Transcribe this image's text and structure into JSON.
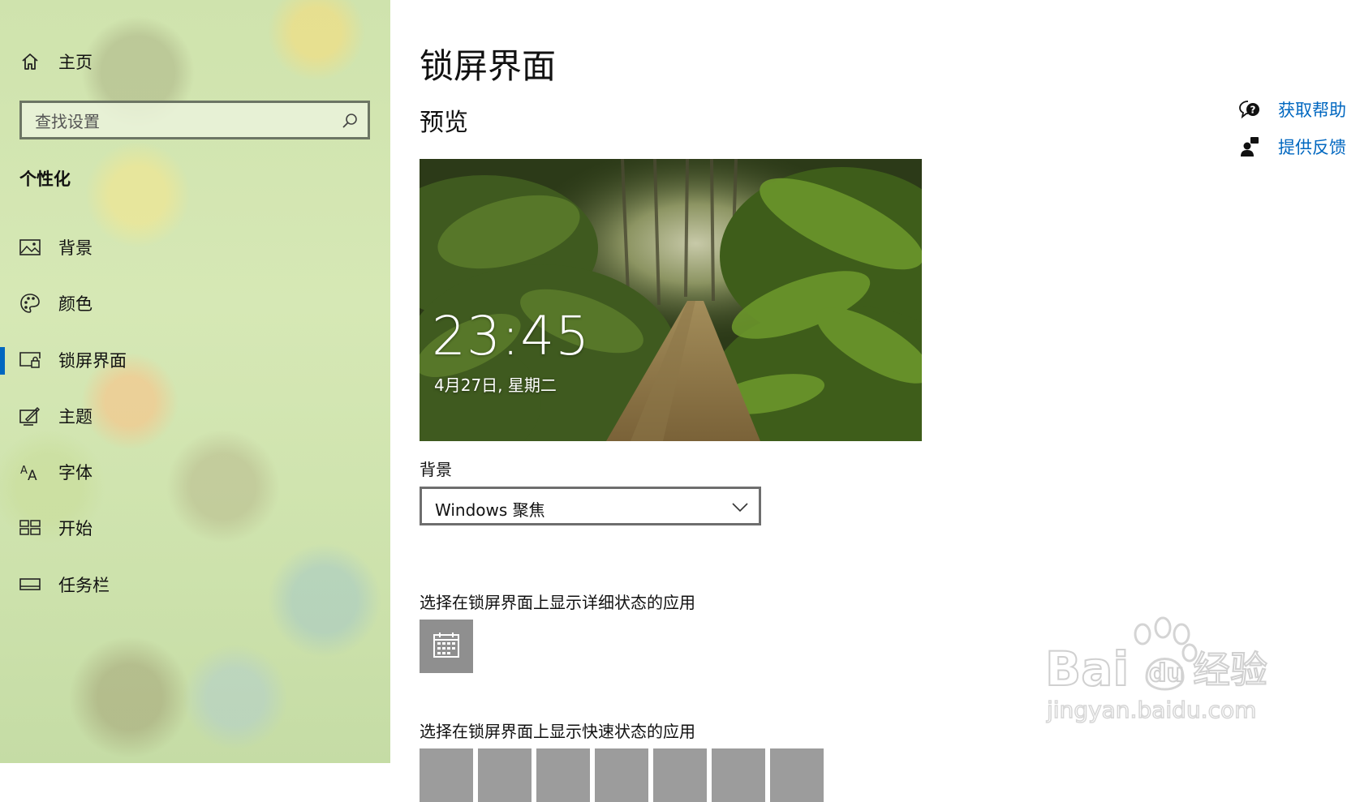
{
  "sidebar": {
    "home_label": "主页",
    "search_placeholder": "查找设置",
    "section_title": "个性化",
    "items": [
      {
        "label": "背景",
        "icon": "picture-icon"
      },
      {
        "label": "颜色",
        "icon": "palette-icon"
      },
      {
        "label": "锁屏界面",
        "icon": "lock-screen-icon",
        "active": true
      },
      {
        "label": "主题",
        "icon": "theme-brush-icon"
      },
      {
        "label": "字体",
        "icon": "font-icon"
      },
      {
        "label": "开始",
        "icon": "start-tiles-icon"
      },
      {
        "label": "任务栏",
        "icon": "taskbar-icon"
      }
    ]
  },
  "main": {
    "title": "锁屏界面",
    "preview_heading": "预览",
    "preview": {
      "time": "23:45",
      "date": "4月27日, 星期二"
    },
    "background_label": "背景",
    "background_value": "Windows 聚焦",
    "detail_status_label": "选择在锁屏界面上显示详细状态的应用",
    "quick_status_label": "选择在锁屏界面上显示快速状态的应用"
  },
  "help": {
    "get_help": "获取帮助",
    "feedback": "提供反馈"
  },
  "watermark": {
    "brand": "Bai",
    "brand2": "du",
    "cn": "经验",
    "url": "jingyan.baidu.com"
  },
  "colors": {
    "accent": "#0067c0",
    "tile": "#8f8f8f"
  }
}
